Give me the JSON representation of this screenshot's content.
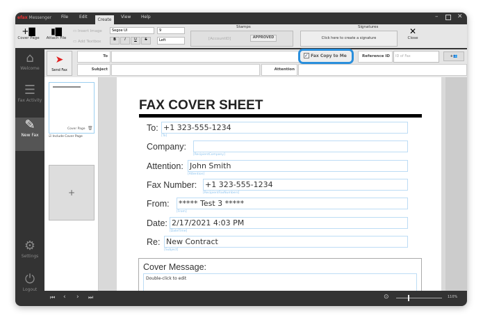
{
  "app": {
    "logo": "efax",
    "title": "Messenger"
  },
  "menu": [
    "File",
    "Edit",
    "Create",
    "View",
    "Help"
  ],
  "active_tab": "Create",
  "ribbon": {
    "cover_page": "Cover Page",
    "attach_file": "Attach File",
    "insert_image": "Insert Image",
    "add_textbox": "Add Textbox",
    "font": "Segoe UI",
    "size": "9",
    "bold": "B",
    "italic": "I",
    "underline": "U",
    "strike": "S",
    "align": "Left",
    "stamps_label": "Stamps",
    "stamp_account": "[AccountID]",
    "stamp_approved": "APPROVED",
    "signatures_label": "Signatures",
    "signature_prompt": "Click here to create a signature",
    "close": "Close"
  },
  "header": {
    "send_fax": "Send Fax",
    "to_label": "To",
    "subject_label": "Subject",
    "attention_label": "Attention",
    "fax_copy": "Fax Copy to Me",
    "fax_copy_checked": true,
    "reference_label": "Reference ID",
    "reference_placeholder": "ID of Fax",
    "accent": "#2a8fdc"
  },
  "sidebar": [
    {
      "label": "Welcome",
      "icon": "home-icon"
    },
    {
      "label": "Fax Activity",
      "icon": "list-icon"
    },
    {
      "label": "New Fax",
      "icon": "edit-icon",
      "active": true
    },
    {
      "label": "Settings",
      "icon": "gear-icon"
    },
    {
      "label": "Logout",
      "icon": "power-icon"
    }
  ],
  "thumbs": {
    "cover_page": "Cover Page",
    "include": "Include Cover Page",
    "include_checked": true,
    "add": "+"
  },
  "cover": {
    "title": "FAX COVER SHEET",
    "fields": [
      {
        "label": "To:",
        "value": "+1 323-555-1234",
        "tag": "[To]"
      },
      {
        "label": "Company:",
        "value": "",
        "tag": "[RecipientCompany]"
      },
      {
        "label": "Attention:",
        "value": "John Smith",
        "tag": "[Attention]"
      },
      {
        "label": "Fax Number:",
        "value": "+1 323-555-1234",
        "tag": "[RecipientFaxNumbers]"
      },
      {
        "label": "From:",
        "value": "***** Test 3 *****",
        "tag": "[From]"
      },
      {
        "label": "Date:",
        "value": "2/17/2021 4:03 PM",
        "tag": "[DateTime]"
      },
      {
        "label": "Re:",
        "value": "New Contract",
        "tag": "[Subject]"
      }
    ],
    "message_label": "Cover Message:",
    "message_placeholder": "Double-click to edit"
  },
  "footer": {
    "zoom": "110%",
    "zoom_fraction": 0.25
  }
}
